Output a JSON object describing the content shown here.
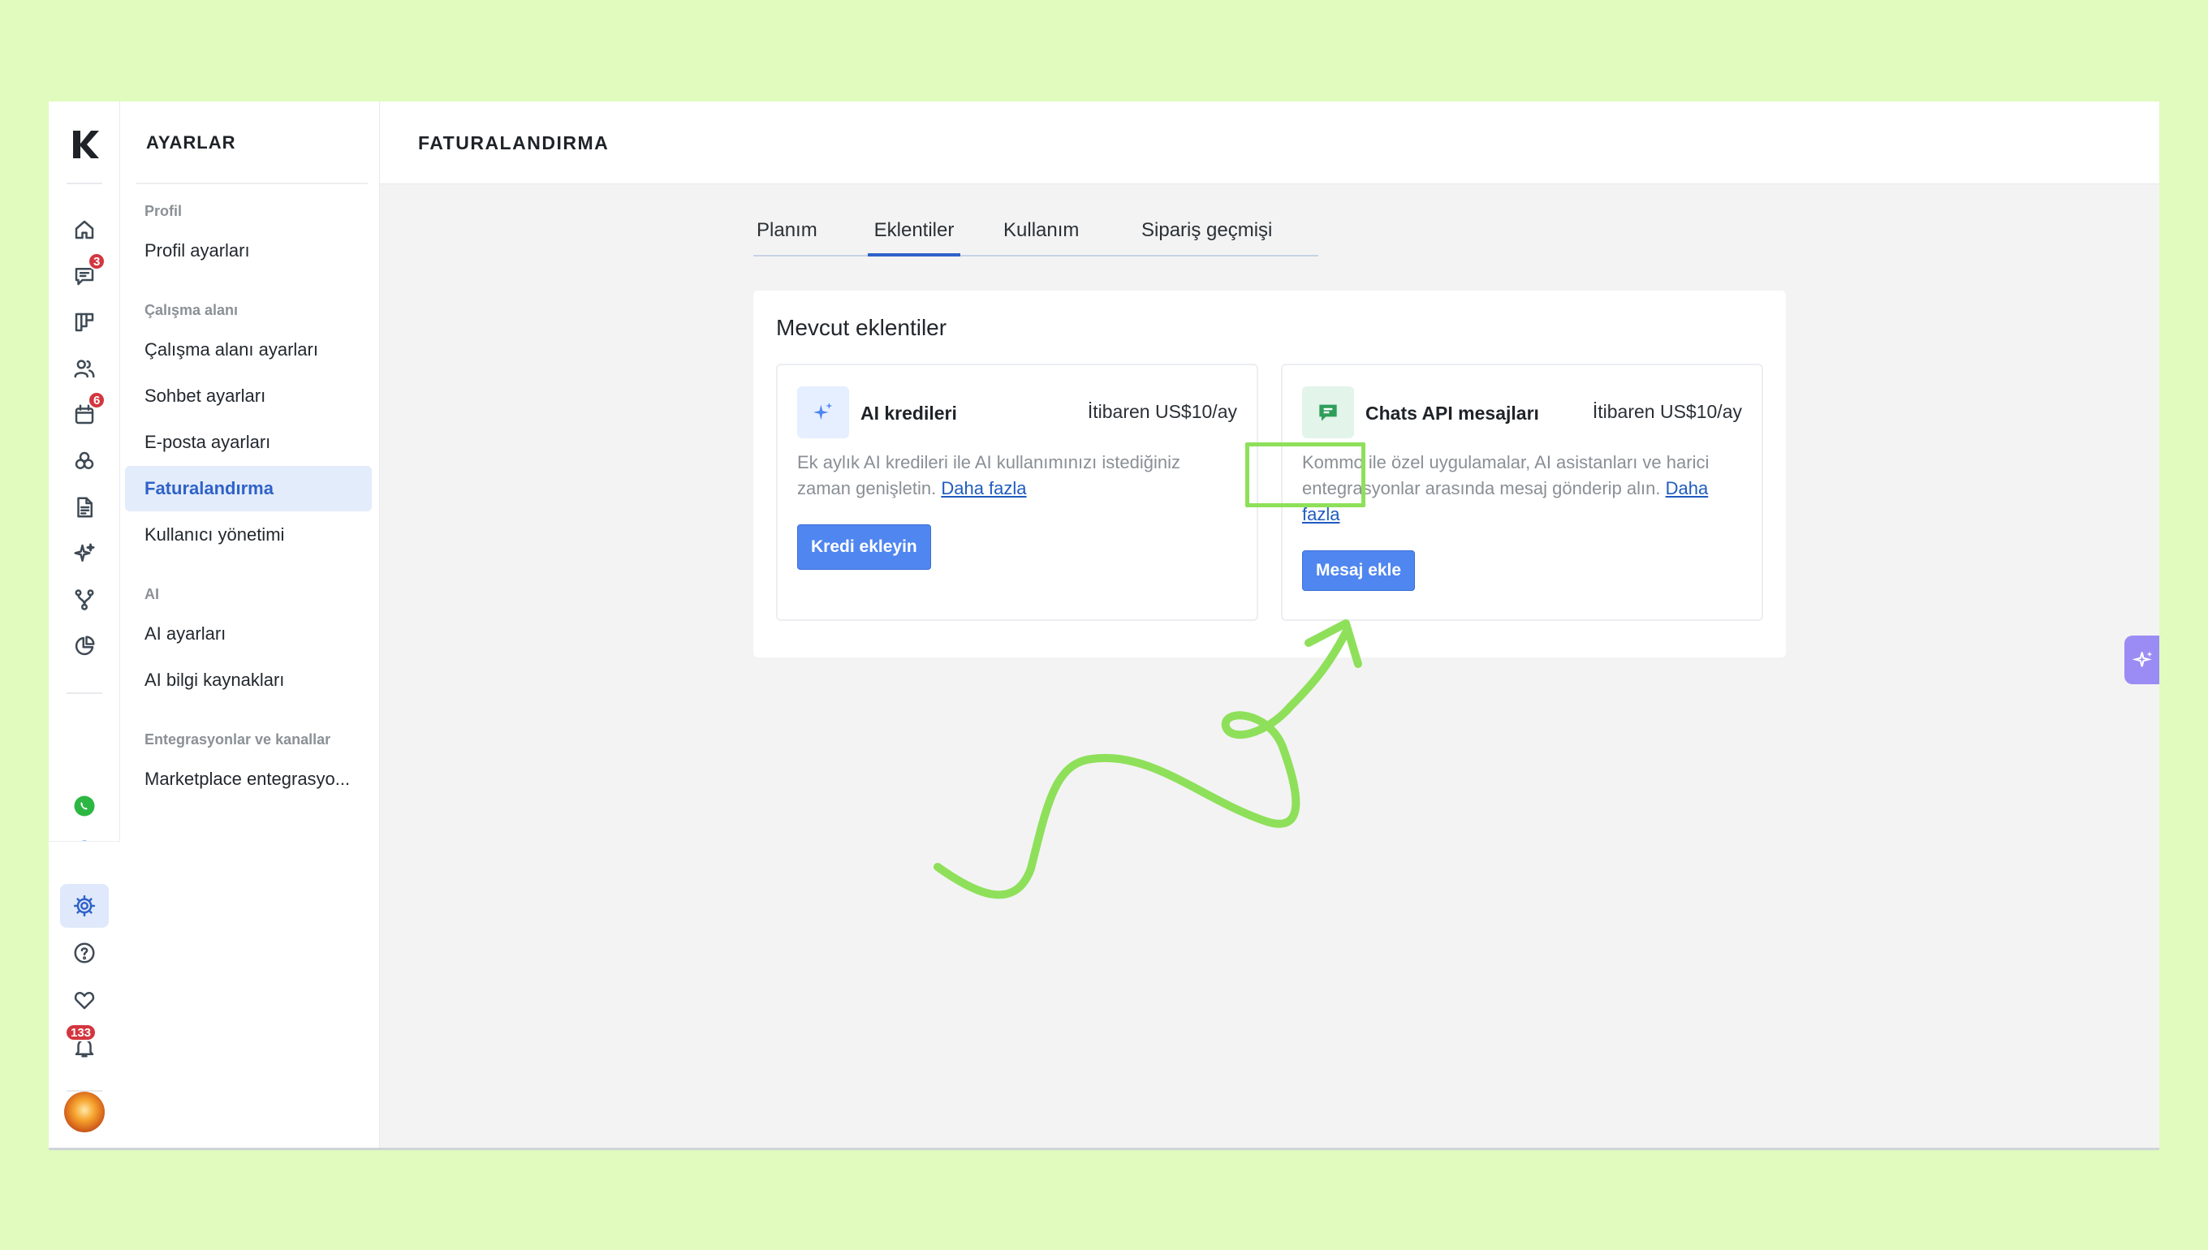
{
  "settings": {
    "heading": "AYARLAR",
    "sections": {
      "profile": "Profil",
      "workspace": "Çalışma alanı",
      "ai": "AI",
      "integrations": "Entegrasyonlar ve kanallar"
    },
    "items": {
      "profile_settings": "Profil ayarları",
      "workspace_settings": "Çalışma alanı ayarları",
      "chat_settings": "Sohbet ayarları",
      "email_settings": "E-posta ayarları",
      "billing": "Faturalandırma",
      "user_management": "Kullanıcı yönetimi",
      "ai_settings": "AI ayarları",
      "ai_sources": "AI bilgi kaynakları",
      "marketplace": "Marketplace entegrasyo..."
    }
  },
  "rail": {
    "badges": {
      "chats": "3",
      "calendar": "6",
      "notifications": "133"
    }
  },
  "page": {
    "title": "FATURALANDIRMA",
    "tabs": [
      "Planım",
      "Eklentiler",
      "Kullanım",
      "Sipariş geçmişi"
    ],
    "active_tab": "Eklentiler"
  },
  "addons": {
    "title": "Mevcut eklentiler",
    "ai_credits": {
      "name": "AI kredileri",
      "price": "İtibaren US$10/ay",
      "description": "Ek aylık AI kredileri ile AI kullanımınızı istediğiniz zaman genişletin.",
      "more_link": "Daha fazla",
      "button": "Kredi ekleyin"
    },
    "chats_api": {
      "name": "Chats API mesajları",
      "price": "İtibaren US$10/ay",
      "description": "Kommo ile özel uygulamalar, AI asistanları ve harici entegrasyonlar arasında mesaj gönderip alın.",
      "more_link": "Daha fazla",
      "button": "Mesaj ekle"
    }
  },
  "colors": {
    "background": "#e0fbbd",
    "accent": "#2f62c8",
    "button": "#4f86f0",
    "highlight": "#8ee05a",
    "badge": "#d3363f"
  }
}
